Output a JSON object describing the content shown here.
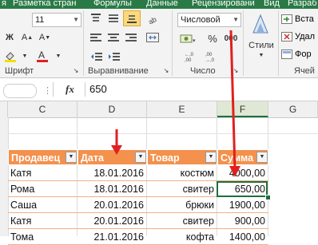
{
  "tabs": [
    "я",
    "Разметка стран",
    "Формулы",
    "Данные",
    "Рецензировани",
    "Вид",
    "Разраб"
  ],
  "ribbon": {
    "font_size": "11",
    "number_format": "Числовой",
    "groups": {
      "font": "Шрифт",
      "alignment": "Выравнивание",
      "number": "Число",
      "cells": "Ячей"
    },
    "styles_label": "Стили",
    "cells_cmds": [
      "Вста",
      "Удал",
      "Фор"
    ],
    "percent": "%",
    "thousands": "000"
  },
  "formula_bar": {
    "fx": "fx",
    "value": "650"
  },
  "columns": [
    "C",
    "D",
    "E",
    "F",
    "G"
  ],
  "table": {
    "headers": [
      "Продавец",
      "Дата",
      "Товар",
      "Сумма"
    ],
    "rows": [
      [
        "Катя",
        "18.01.2016",
        "костюм",
        "4000,00"
      ],
      [
        "Рома",
        "18.01.2016",
        "свитер",
        "650,00"
      ],
      [
        "Саша",
        "20.01.2016",
        "брюки",
        "1900,00"
      ],
      [
        "Катя",
        "20.01.2016",
        "свитер",
        "900,00"
      ],
      [
        "Тома",
        "21.01.2016",
        "кофта",
        "1400,00"
      ]
    ]
  },
  "colors": {
    "accent_green": "#2a7a46",
    "table_header": "#f3914d",
    "arrow_red": "#e02020",
    "selection": "#1f6f3f"
  }
}
